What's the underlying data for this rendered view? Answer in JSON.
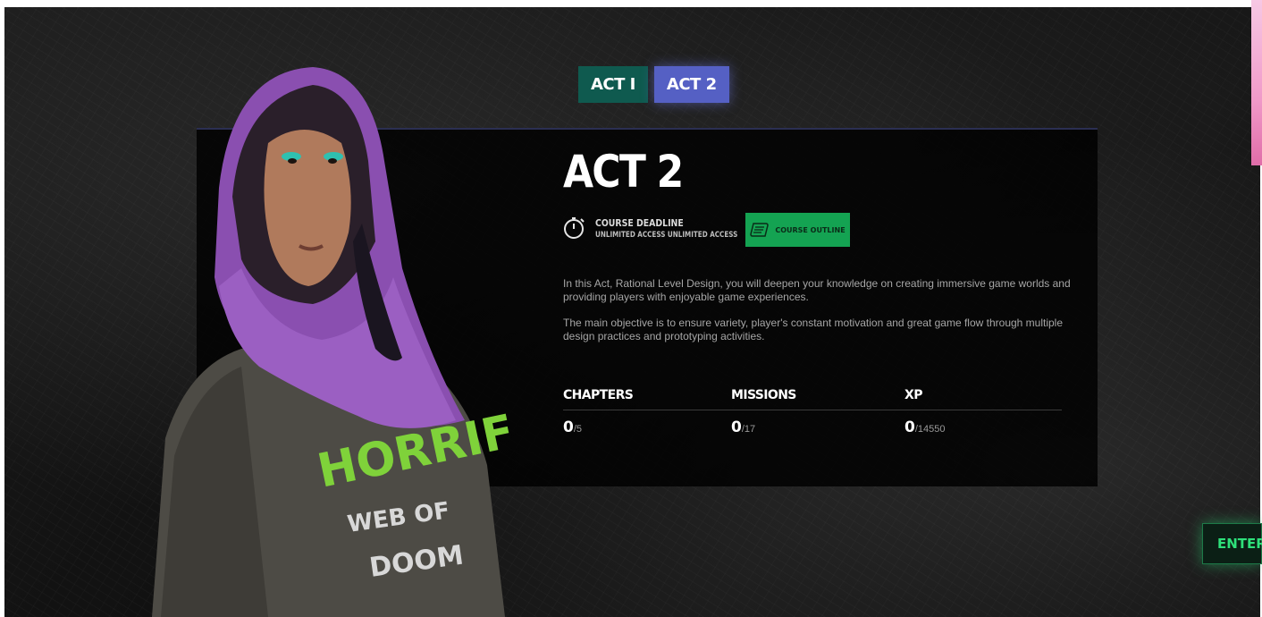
{
  "tabs": [
    {
      "label": "ACT I"
    },
    {
      "label": "ACT 2"
    }
  ],
  "act": {
    "title": "ACT 2",
    "deadline_label": "COURSE DEADLINE",
    "deadline_value": "UNLIMITED ACCESS UNLIMITED ACCESS",
    "outline_button": "COURSE OUTLINE",
    "description": [
      "In this Act, Rational Level Design, you will deepen your knowledge on creating immersive game worlds and providing players with enjoyable game experiences.",
      "The main objective is to ensure variety, player's constant motivation and great game flow through multiple design practices and prototyping activities."
    ]
  },
  "stats": {
    "chapters": {
      "label": "CHAPTERS",
      "value": "0",
      "total": "/5"
    },
    "missions": {
      "label": "MISSIONS",
      "value": "0",
      "total": "/17"
    },
    "xp": {
      "label": "XP",
      "value": "0",
      "total": "/14550"
    }
  },
  "enter_button": "ENTER",
  "character_shirt": {
    "line1": "HORRIFIC",
    "line2": "WEB OF",
    "line3": "DOOM"
  },
  "colors": {
    "tab_active": "#5560c4",
    "tab_inactive": "#0f5a4f",
    "outline_button": "#14a352",
    "enter_text": "#2ee07a",
    "hood": "#8a4fb0"
  }
}
